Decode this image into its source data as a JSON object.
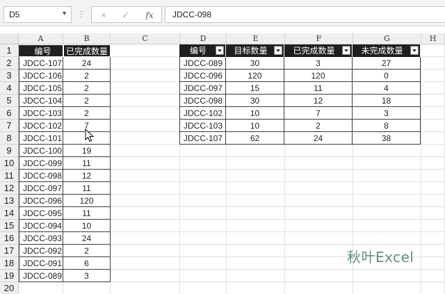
{
  "formula_bar": {
    "name_box": "D5",
    "cancel_icon": "×",
    "confirm_icon": "✓",
    "fx_label": "fx",
    "formula_text": "JDCC-098"
  },
  "columns": [
    "A",
    "B",
    "C",
    "D",
    "E",
    "F",
    "G",
    "H"
  ],
  "rows": [
    "1",
    "2",
    "3",
    "4",
    "5",
    "6",
    "7",
    "8",
    "9",
    "10",
    "11",
    "12",
    "13",
    "14",
    "15",
    "16",
    "17",
    "18",
    "19",
    "20"
  ],
  "left_table": {
    "headers": [
      "编号",
      "已完成数量"
    ],
    "rows": [
      [
        "JDCC-107",
        "24"
      ],
      [
        "JDCC-106",
        "2"
      ],
      [
        "JDCC-105",
        "2"
      ],
      [
        "JDCC-104",
        "2"
      ],
      [
        "JDCC-103",
        "2"
      ],
      [
        "JDCC-102",
        "7"
      ],
      [
        "JDCC-101",
        ""
      ],
      [
        "JDCC-100",
        "19"
      ],
      [
        "JDCC-099",
        "11"
      ],
      [
        "JDCC-098",
        "12"
      ],
      [
        "JDCC-097",
        "11"
      ],
      [
        "JDCC-096",
        "120"
      ],
      [
        "JDCC-095",
        "11"
      ],
      [
        "JDCC-094",
        "10"
      ],
      [
        "JDCC-093",
        "24"
      ],
      [
        "JDCC-092",
        "2"
      ],
      [
        "JDCC-091",
        "6"
      ],
      [
        "JDCC-089",
        "3"
      ]
    ]
  },
  "right_table": {
    "headers": [
      "编号",
      "目标数量",
      "已完成数量",
      "未完成数量"
    ],
    "rows": [
      [
        "JDCC-089",
        "30",
        "3",
        "27"
      ],
      [
        "JDCC-096",
        "120",
        "120",
        "0"
      ],
      [
        "JDCC-097",
        "15",
        "11",
        "4"
      ],
      [
        "JDCC-098",
        "30",
        "12",
        "18"
      ],
      [
        "JDCC-102",
        "10",
        "7",
        "3"
      ],
      [
        "JDCC-103",
        "10",
        "2",
        "8"
      ],
      [
        "JDCC-107",
        "62",
        "24",
        "38"
      ]
    ]
  },
  "watermark": "秋叶Excel"
}
